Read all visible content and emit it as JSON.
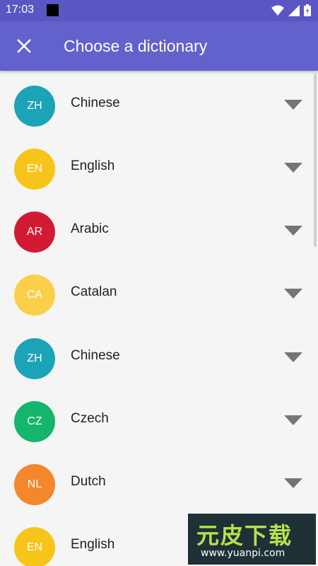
{
  "status_bar": {
    "time": "17:03"
  },
  "app_bar": {
    "title": "Choose a dictionary"
  },
  "dictionaries": [
    {
      "code": "ZH",
      "name": "Chinese",
      "color": "#1ba3b7"
    },
    {
      "code": "EN",
      "name": "English",
      "color": "#f7c51a"
    },
    {
      "code": "AR",
      "name": "Arabic",
      "color": "#d21a34"
    },
    {
      "code": "CA",
      "name": "Catalan",
      "color": "#fad04a"
    },
    {
      "code": "ZH",
      "name": "Chinese",
      "color": "#1ba3b7"
    },
    {
      "code": "CZ",
      "name": "Czech",
      "color": "#14b56c"
    },
    {
      "code": "NL",
      "name": "Dutch",
      "color": "#f4862b"
    },
    {
      "code": "EN",
      "name": "English",
      "color": "#f7c51a"
    }
  ],
  "watermark": {
    "brand": "元皮下载",
    "url": "www.yuanpi.com"
  },
  "colors": {
    "primary": "#6361cb",
    "status_bar": "#5a57c4",
    "expand_icon": "#757575"
  },
  "icons": {
    "close": "close-icon",
    "expand": "triangle-down-icon",
    "wifi": "wifi-icon",
    "signal": "signal-icon",
    "battery": "battery-icon"
  }
}
